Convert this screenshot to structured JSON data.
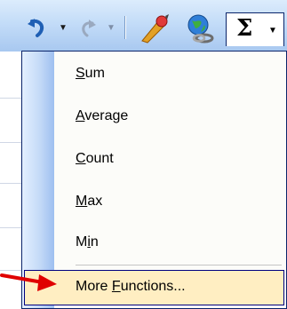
{
  "toolbar": {
    "buttons": [
      {
        "name": "undo-button",
        "icon": "undo-icon"
      },
      {
        "name": "redo-button",
        "icon": "redo-icon"
      },
      {
        "name": "drawing-button",
        "icon": "paint-brush-icon"
      },
      {
        "name": "hyperlink-button",
        "icon": "globe-link-icon"
      },
      {
        "name": "autosum-button",
        "icon": "sigma-icon",
        "label": "Σ"
      }
    ]
  },
  "menu": {
    "items": [
      {
        "prefix": "",
        "mnemonic": "S",
        "suffix": "um"
      },
      {
        "prefix": "",
        "mnemonic": "A",
        "suffix": "verage"
      },
      {
        "prefix": "",
        "mnemonic": "C",
        "suffix": "ount"
      },
      {
        "prefix": "",
        "mnemonic": "M",
        "suffix": "ax"
      },
      {
        "prefix": "M",
        "mnemonic": "i",
        "suffix": "n"
      }
    ],
    "highlighted": {
      "prefix": "More ",
      "mnemonic": "F",
      "suffix": "unctions..."
    }
  },
  "colors": {
    "accent_border": "#0a246a",
    "highlight_bg": "#ffeec2",
    "arrow": "#e00000"
  }
}
